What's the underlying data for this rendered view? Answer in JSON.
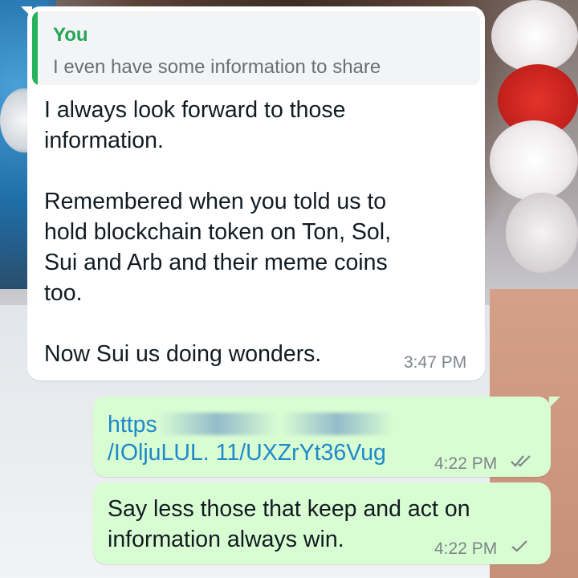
{
  "incoming": {
    "quote": {
      "author": "You",
      "text": "I even have some information to share"
    },
    "text": "I always look forward to those\ninformation.\n\nRemembered when you told us to\nhold blockchain token on Ton, Sol,\nSui and Arb and their meme coins\ntoo.\n\nNow Sui us doing wonders.",
    "time": "3:47 PM"
  },
  "outgoing": [
    {
      "link_start": "https",
      "link_line2": "/IOljuLUL. 11/UXZrYt36Vug",
      "time": "4:22 PM",
      "status_icon": "double-check-icon"
    },
    {
      "text": "Say less those that keep and act on information always win.",
      "time": "4:22 PM",
      "status_icon": "single-check-icon"
    }
  ],
  "colors": {
    "incoming_bubble": "#ffffff",
    "outgoing_bubble": "#d9fdd3",
    "quote_accent": "#25b35a",
    "link": "#1e88c9"
  }
}
